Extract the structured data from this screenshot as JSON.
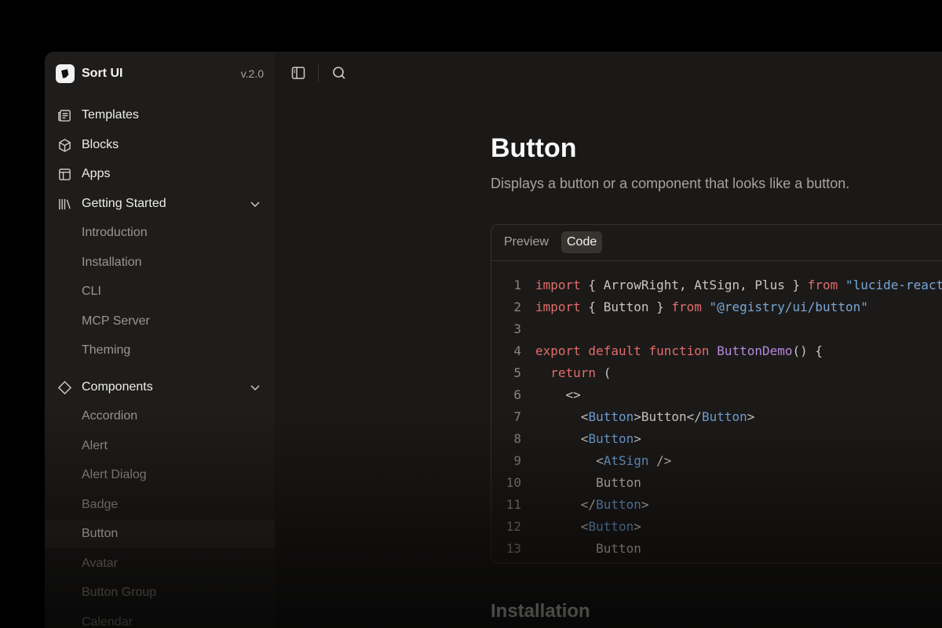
{
  "brand": {
    "name": "Sort UI",
    "version": "v.2.0",
    "logo_icon": "sort-ui-logo-icon"
  },
  "sidebar": {
    "main_items": [
      {
        "label": "Templates",
        "icon": "newspaper-icon"
      },
      {
        "label": "Blocks",
        "icon": "box-icon"
      },
      {
        "label": "Apps",
        "icon": "layout-icon"
      }
    ],
    "getting_started": {
      "label": "Getting Started",
      "icon": "library-icon",
      "items": [
        "Introduction",
        "Installation",
        "CLI",
        "MCP Server",
        "Theming"
      ]
    },
    "components": {
      "label": "Components",
      "icon": "diamond-icon",
      "items": [
        "Accordion",
        "Alert",
        "Alert Dialog",
        "Badge",
        "Button",
        "Avatar",
        "Button Group",
        "Calendar"
      ],
      "active": "Button"
    }
  },
  "toolbar": {
    "sidebar_toggle_icon": "panel-left-icon",
    "search_icon": "search-icon"
  },
  "page": {
    "title": "Button",
    "description": "Displays a button or a component that looks like a button.",
    "section_title": "Installation"
  },
  "code_card": {
    "tabs": [
      "Preview",
      "Code"
    ],
    "active_tab": "Code",
    "line_numbers": [
      "1",
      "2",
      "3",
      "4",
      "5",
      "6",
      "7",
      "8",
      "9",
      "10",
      "11",
      "12",
      "13"
    ]
  },
  "code": {
    "l1": {
      "kw1": "import",
      "p1": " { ArrowRight, AtSign, Plus } ",
      "kw2": "from",
      "str": " \"lucide-react\""
    },
    "l2": {
      "kw1": "import",
      "p1": " { Button } ",
      "kw2": "from",
      "str": " \"@registry/ui/button\""
    },
    "l4": {
      "kw": "export default function",
      "fn": " ButtonDemo",
      "p1": "() {"
    },
    "l5": {
      "kw": "  return",
      "p1": " ("
    },
    "l6": {
      "p1": "    <>"
    },
    "l7": {
      "p1": "      <",
      "tag1": "Button",
      "p2": ">Button</",
      "tag2": "Button",
      "p3": ">"
    },
    "l8": {
      "p1": "      <",
      "tag": "Button",
      "p2": ">"
    },
    "l9": {
      "p1": "        <",
      "tag": "AtSign",
      "p2": " />"
    },
    "l10": {
      "p1": "        Button"
    },
    "l11": {
      "p1": "      </",
      "tag": "Button",
      "p2": ">"
    },
    "l12": {
      "p1": "      <",
      "tag": "Button",
      "p2": ">"
    },
    "l13": {
      "p1": "        Button"
    }
  }
}
